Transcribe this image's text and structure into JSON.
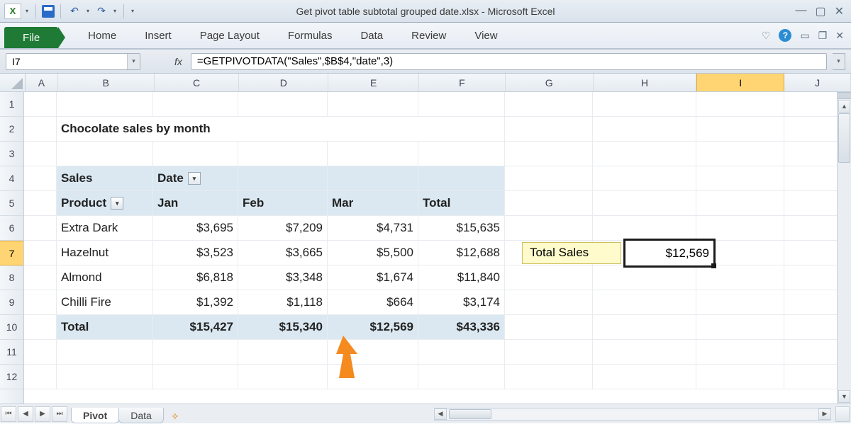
{
  "title": "Get pivot table subtotal grouped date.xlsx  -  Microsoft Excel",
  "name_box": "I7",
  "fx_label": "fx",
  "formula": "=GETPIVOTDATA(\"Sales\",$B$4,\"date\",3)",
  "ribbon": {
    "file": "File",
    "tabs": [
      "Home",
      "Insert",
      "Page Layout",
      "Formulas",
      "Data",
      "Review",
      "View"
    ]
  },
  "columns": [
    "A",
    "B",
    "C",
    "D",
    "E",
    "F",
    "G",
    "H",
    "I",
    "J"
  ],
  "row_numbers": [
    "1",
    "2",
    "3",
    "4",
    "5",
    "6",
    "7",
    "8",
    "9",
    "10",
    "11",
    "12"
  ],
  "sheet_title": "Chocolate sales by month",
  "pivot": {
    "measure": "Sales",
    "col_field": "Date",
    "row_field": "Product",
    "months": [
      "Jan",
      "Feb",
      "Mar"
    ],
    "total_label": "Total",
    "rows": [
      {
        "name": "Extra Dark",
        "v": [
          "$3,695",
          "$7,209",
          "$4,731",
          "$15,635"
        ]
      },
      {
        "name": "Hazelnut",
        "v": [
          "$3,523",
          "$3,665",
          "$5,500",
          "$12,688"
        ]
      },
      {
        "name": "Almond",
        "v": [
          "$6,818",
          "$3,348",
          "$1,674",
          "$11,840"
        ]
      },
      {
        "name": "Chilli Fire",
        "v": [
          "$1,392",
          "$1,118",
          "$664",
          "$3,174"
        ]
      }
    ],
    "grand": [
      "$15,427",
      "$15,340",
      "$12,569",
      "$43,336"
    ]
  },
  "side": {
    "label": "Total Sales",
    "value": "$12,569"
  },
  "sheets": {
    "active": "Pivot",
    "other": "Data"
  }
}
